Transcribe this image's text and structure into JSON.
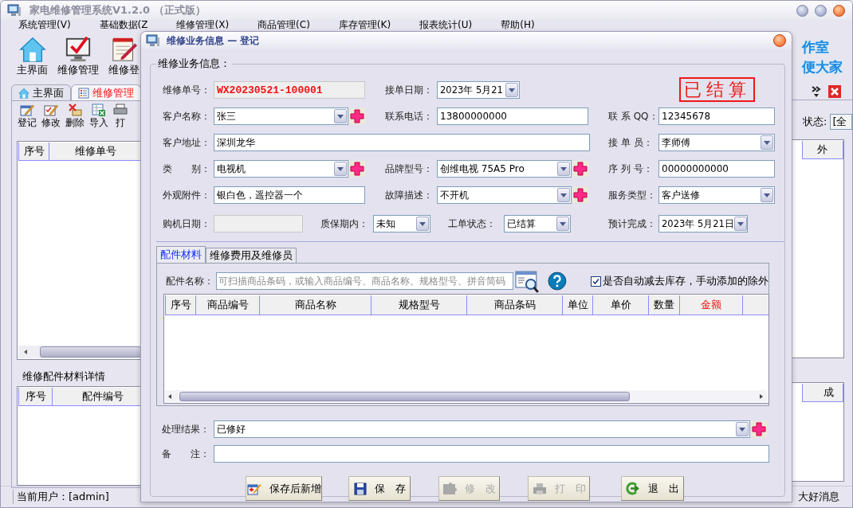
{
  "app": {
    "title": "家电维修管理系统V1.2.0 （正式版）",
    "menu": [
      "系统管理(V)",
      "基础数据(Z",
      "维修管理(X)",
      "商品管理(C)",
      "库存管理(K)",
      "报表统计(U)",
      "帮助(H)"
    ],
    "toolbar": [
      {
        "label": "主界面",
        "kind": "home"
      },
      {
        "label": "维修管理",
        "kind": "monitor"
      },
      {
        "label": "维修登",
        "kind": "notepad"
      }
    ],
    "banner": [
      "作室",
      "便大家"
    ],
    "tabs": [
      {
        "label": "主界面",
        "kind": "home",
        "selected": false
      },
      {
        "label": "维修管理",
        "kind": "list",
        "selected": true
      }
    ],
    "actions": [
      {
        "label": "登记",
        "kind": "register"
      },
      {
        "label": "修改",
        "kind": "edit"
      },
      {
        "label": "删除",
        "kind": "delete"
      },
      {
        "label": "导入",
        "kind": "import"
      },
      {
        "label": "打",
        "kind": "print"
      }
    ],
    "status_filter": {
      "label": "状态:",
      "value": "[全"
    },
    "orders_table": {
      "columns": [
        "序号",
        "维修单号"
      ],
      "right_column": "外"
    },
    "parts_section": {
      "title": "维修配件材料详情",
      "columns": [
        "序号",
        "配件编号"
      ],
      "right_column": "成"
    },
    "status_bar": {
      "user": "当前用户：[admin]",
      "message": "大好消息"
    }
  },
  "dialog": {
    "title": "维修业务信息 — 登记",
    "group": "维修业务信息：",
    "stamp": "已结算",
    "rows": [
      [
        {
          "label": "维修单号：",
          "kind": "serial",
          "value": "WX20230521-100001"
        },
        {
          "label": "接单日期：",
          "kind": "date",
          "value": "2023年 5月21"
        }
      ],
      [
        {
          "label": "客户名称：",
          "kind": "combo",
          "value": "张三",
          "add": true
        },
        {
          "label": "联系电话：",
          "kind": "text",
          "value": "13800000000"
        },
        {
          "label": "联 系 QQ：",
          "kind": "text",
          "value": "12345678"
        }
      ],
      [
        {
          "label": "客户地址：",
          "kind": "text",
          "value": "深圳龙华"
        },
        "",
        {
          "label": "接 单 员：",
          "kind": "combo",
          "value": "李师傅"
        }
      ],
      [
        {
          "label": "类　　别：",
          "kind": "combo",
          "value": "电视机",
          "add": true
        },
        {
          "label": "品牌型号：",
          "kind": "combo",
          "value": "创维电视 75A5 Pro",
          "add": true
        },
        {
          "label": "序 列 号：",
          "kind": "text",
          "value": "00000000000"
        }
      ],
      [
        {
          "label": "外观附件：",
          "kind": "text",
          "value": "银白色，遥控器一个"
        },
        {
          "label": "故障描述：",
          "kind": "combo",
          "value": "不开机",
          "add": true
        },
        {
          "label": "服务类型：",
          "kind": "combo",
          "value": "客户送修"
        }
      ]
    ],
    "status_row": [
      {
        "label": "购机日期：",
        "kind": "readonly"
      },
      {
        "label": "质保期内：",
        "kind": "combo",
        "value": "未知"
      },
      {
        "label": "工单状态：",
        "kind": "combo",
        "value": "已结算"
      },
      {
        "label": "预计完成：",
        "kind": "date",
        "value": "2023年 5月21日"
      }
    ],
    "tabs": [
      {
        "label": "配件材料",
        "selected": true
      },
      {
        "label": "维修费用及维修员",
        "selected": false
      }
    ],
    "parts": {
      "label": "配件名称：",
      "placeholder": "可扫描商品条码，或输入商品编号、商品名称、规格型号、拼音简码",
      "auto_deduct": {
        "label": "是否自动减去库存，手动添加的除外",
        "checked": true
      },
      "columns": [
        {
          "label": "序号",
          "highlight": false
        },
        {
          "label": "商品编号",
          "highlight": false
        },
        {
          "label": "商品名称",
          "highlight": false
        },
        {
          "label": "规格型号",
          "highlight": false
        },
        {
          "label": "商品条码",
          "highlight": false
        },
        {
          "label": "单位",
          "highlight": false
        },
        {
          "label": "单价",
          "highlight": false
        },
        {
          "label": "数量",
          "highlight": false
        },
        {
          "label": "金额",
          "highlight": true
        }
      ]
    },
    "result": {
      "label": "处理结果：",
      "value": "已修好",
      "add": true
    },
    "remark": {
      "label": "备　　注："
    },
    "buttons": [
      {
        "label": "保存后新增",
        "kind": "save_new",
        "disabled": false
      },
      {
        "label": "保　存",
        "kind": "save",
        "disabled": false
      },
      {
        "label": "修　改",
        "kind": "edit",
        "disabled": true
      },
      {
        "label": "打　印",
        "kind": "print",
        "disabled": true
      },
      {
        "label": "退　出",
        "kind": "exit",
        "disabled": false
      }
    ]
  }
}
